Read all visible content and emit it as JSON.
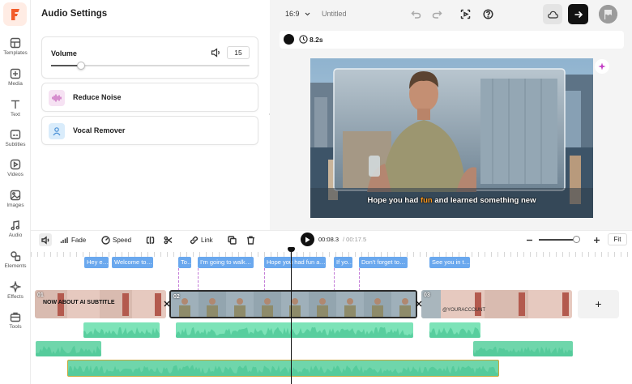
{
  "app": {
    "logo_letter": "F",
    "brand_color": "#f25c2a"
  },
  "rail": [
    {
      "label": "Templates",
      "icon": "templates-icon"
    },
    {
      "label": "Media",
      "icon": "media-icon"
    },
    {
      "label": "Text",
      "icon": "text-icon"
    },
    {
      "label": "Subtitles",
      "icon": "subtitles-icon"
    },
    {
      "label": "Videos",
      "icon": "videos-icon"
    },
    {
      "label": "Images",
      "icon": "images-icon"
    },
    {
      "label": "Audio",
      "icon": "audio-icon"
    },
    {
      "label": "Elements",
      "icon": "elements-icon"
    },
    {
      "label": "Effects",
      "icon": "effects-icon"
    },
    {
      "label": "Tools",
      "icon": "tools-icon"
    }
  ],
  "panel": {
    "title": "Audio Settings",
    "volume": {
      "label": "Volume",
      "value": "15",
      "level": 0.15
    },
    "reduce_noise": {
      "label": "Reduce Noise",
      "icon": "waveform-icon"
    },
    "vocal_remover": {
      "label": "Vocal Remover",
      "icon": "person-icon"
    }
  },
  "topbar": {
    "aspect_ratio": "16:9",
    "project_name": "Untitled"
  },
  "preview": {
    "duration": "8.2s",
    "subtitle_before": "Hope you had ",
    "subtitle_highlight": "fun",
    "subtitle_after": " and learned something new",
    "highlight_color": "#ff9a1f"
  },
  "timeline_toolbar": {
    "fade_label": "Fade",
    "speed_label": "Speed",
    "link_label": "Link",
    "time_current": "00:08.3",
    "time_total": "/ 00:17.5",
    "fit_label": "Fit",
    "zoom_level": 0.85
  },
  "captions": [
    "Hey e…",
    "Welcome to…",
    "To…",
    "I'm going to walk…",
    "Hope you had fun a…",
    "If yo…",
    "Don't forget to…",
    "See you in t…"
  ],
  "clips": [
    {
      "num": "01",
      "thumb_text": "NOW ABOUT AI SUBTITLE"
    },
    {
      "num": "02"
    },
    {
      "num": "03",
      "thumb_text": "@YOURACCOUNT"
    }
  ],
  "add_clip_symbol": "+"
}
